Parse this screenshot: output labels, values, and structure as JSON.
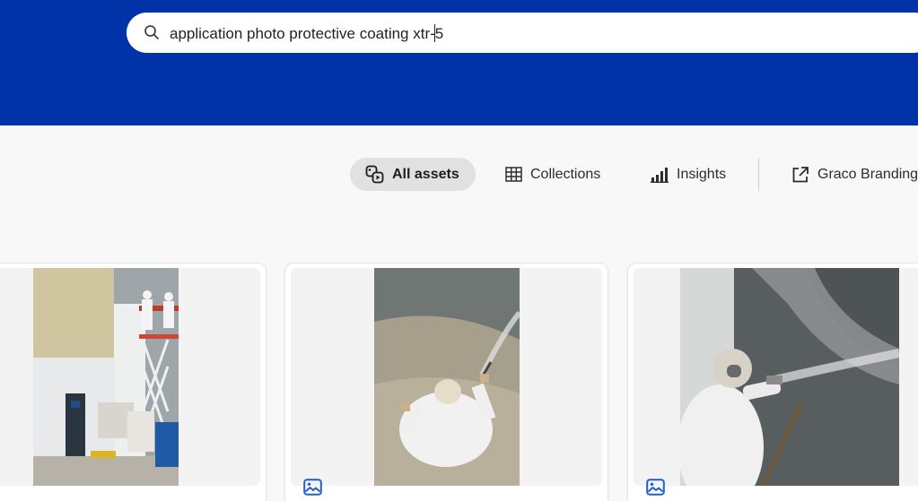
{
  "search": {
    "query": "application photo protective coating xtr-5",
    "query_before_caret": "application photo protective coating xtr-",
    "query_after_caret": "5"
  },
  "nav": {
    "tabs": [
      {
        "label": "All assets",
        "icon": "assets-icon",
        "active": true
      },
      {
        "label": "Collections",
        "icon": "grid-icon",
        "active": false
      },
      {
        "label": "Insights",
        "icon": "bar-chart-icon",
        "active": false
      },
      {
        "label": "Graco Branding",
        "icon": "external-link-icon",
        "active": false
      }
    ]
  },
  "assets": [
    {
      "type": "image",
      "type_icon": "image-icon",
      "subject": "workers on scissor lift spraying coating on tank wall with sprayer equipment"
    },
    {
      "type": "image",
      "type_icon": "image-icon",
      "subject": "overhead view of worker in white suit spraying floor"
    },
    {
      "type": "image",
      "type_icon": "image-icon",
      "subject": "worker in respirator spraying coating on wall"
    }
  ],
  "colors": {
    "banner": "#0032a8",
    "page_bg": "#f8f8f8",
    "active_tab_bg": "#e1e1e1",
    "icon_blue": "#1e5fd6"
  }
}
